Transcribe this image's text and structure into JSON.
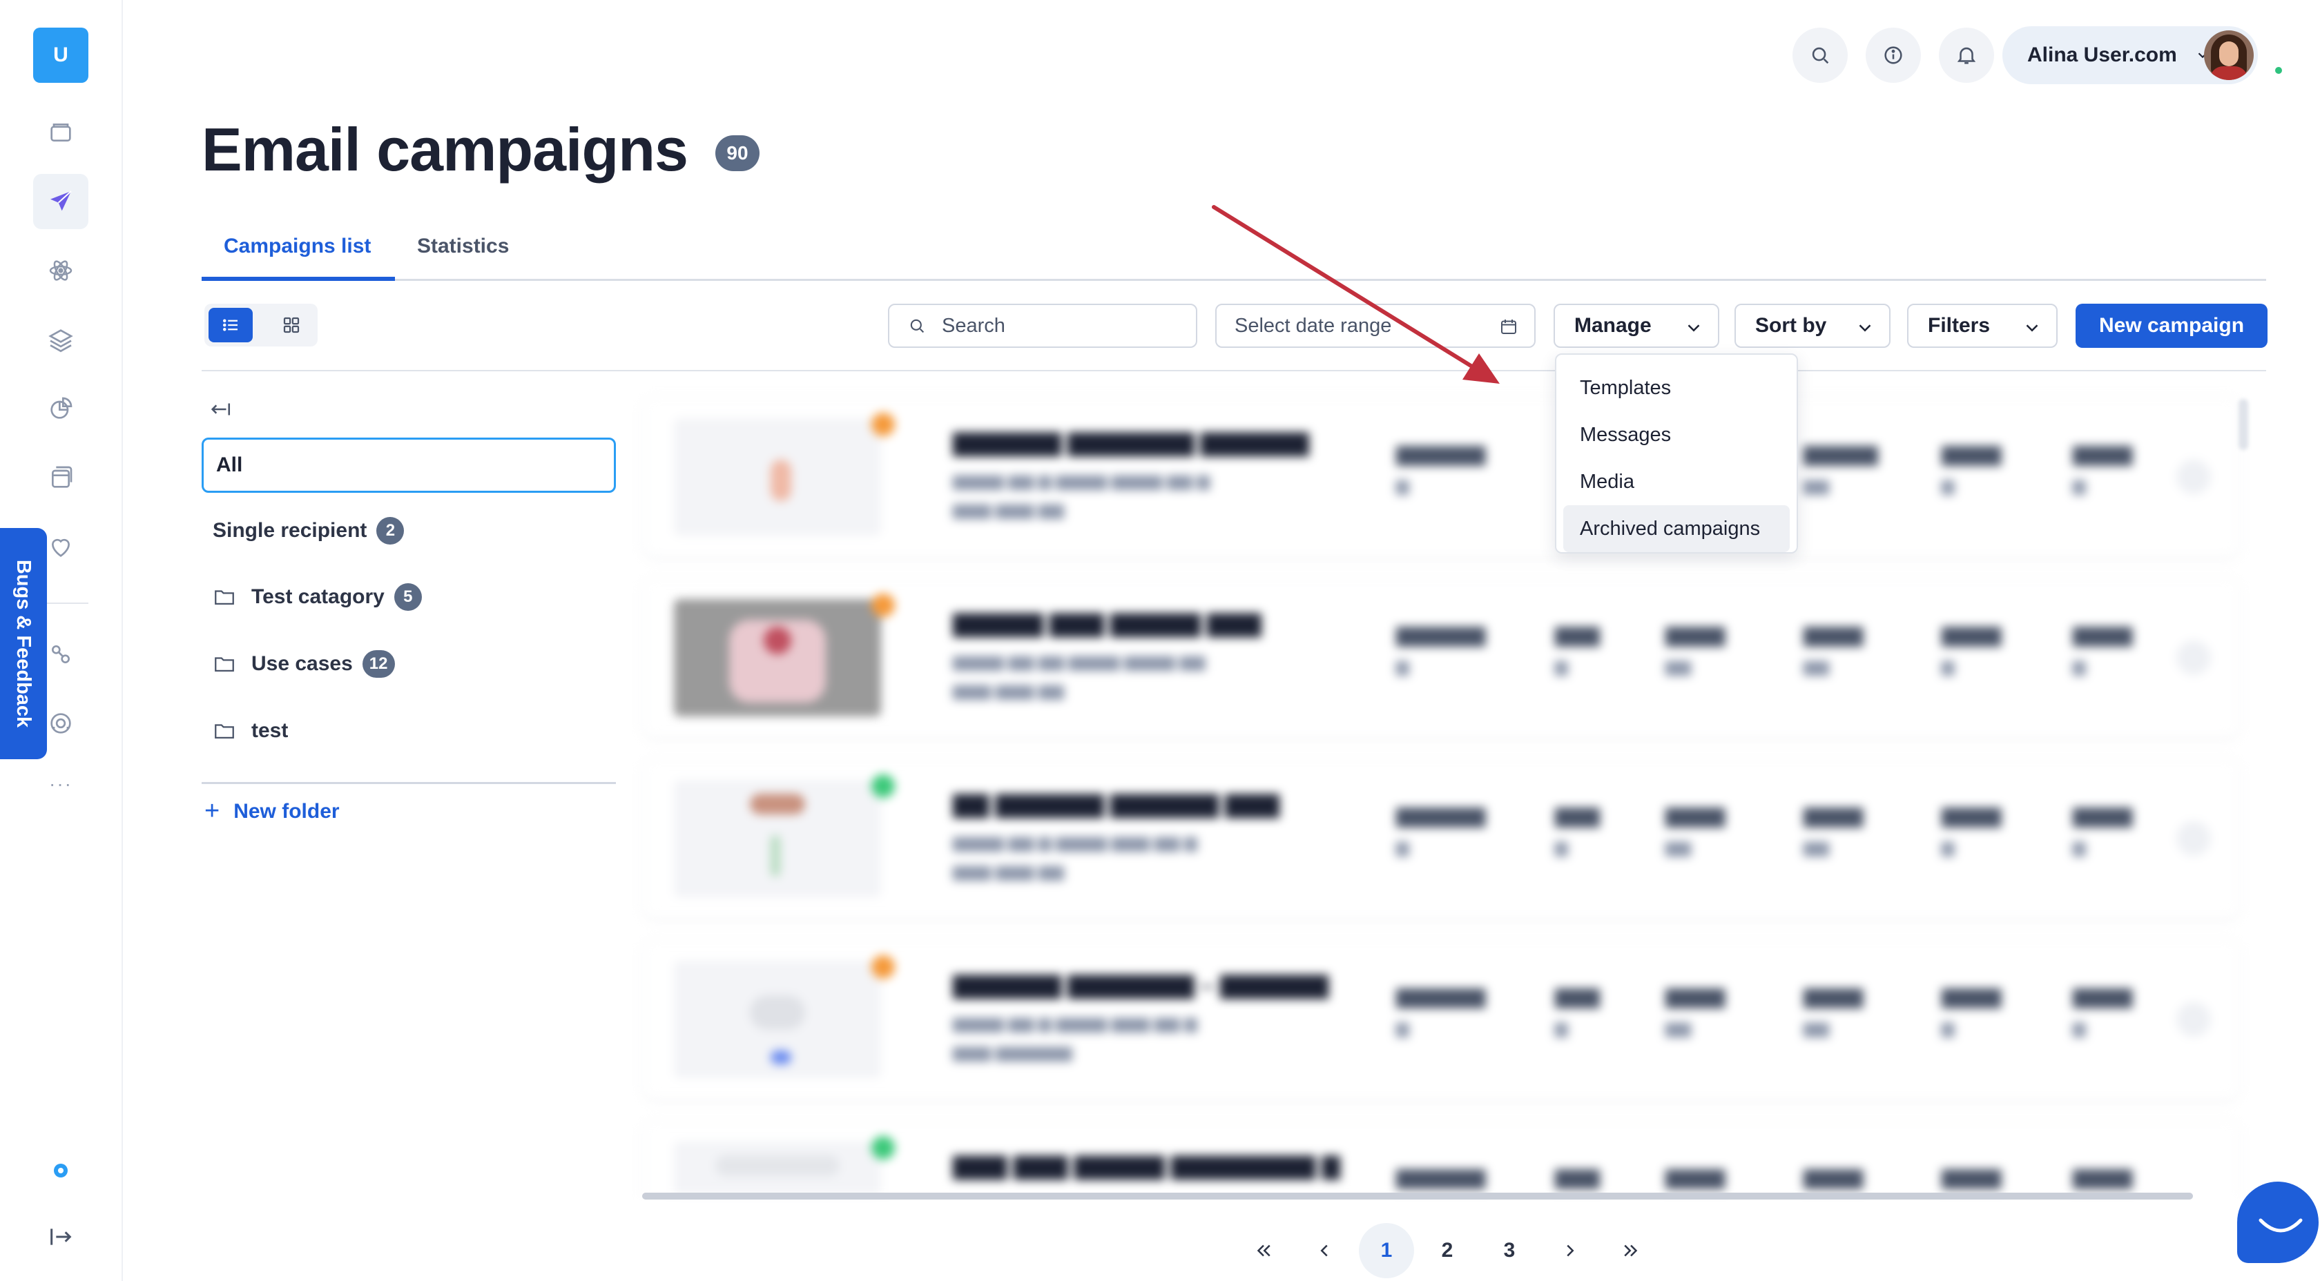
{
  "app": {
    "logo_letter": "U"
  },
  "rail": {
    "items": [
      {
        "name": "storage-icon"
      },
      {
        "name": "send-icon"
      },
      {
        "name": "atom-icon"
      },
      {
        "name": "layers-icon"
      },
      {
        "name": "analytics-icon"
      },
      {
        "name": "pages-icon"
      },
      {
        "name": "heart-icon"
      },
      {
        "name": "automation-icon"
      },
      {
        "name": "support-icon"
      }
    ],
    "more": "···",
    "bottom": [
      {
        "name": "settings-icon"
      },
      {
        "name": "logout-icon"
      }
    ]
  },
  "feedback_tab": {
    "label": "Bugs & Feedback"
  },
  "topbar": {
    "icons": [
      "search-icon",
      "info-icon",
      "bell-icon"
    ],
    "user": {
      "name": "Alina User.com"
    }
  },
  "page": {
    "title": "Email campaigns",
    "count": "90"
  },
  "tabs": [
    {
      "label": "Campaigns list",
      "active": true
    },
    {
      "label": "Statistics",
      "active": false
    }
  ],
  "toolbar": {
    "search_placeholder": "Search",
    "date_placeholder": "Select date range",
    "manage_label": "Manage",
    "sort_label": "Sort by",
    "filters_label": "Filters",
    "new_campaign_label": "New campaign"
  },
  "manage_menu": {
    "items": [
      "Templates",
      "Messages",
      "Media",
      "Archived campaigns"
    ],
    "highlighted": "Archived campaigns"
  },
  "folders": {
    "all_label": "All",
    "items": [
      {
        "label": "Single recipient",
        "count": "2",
        "folder": false
      },
      {
        "label": "Test catagory",
        "count": "5",
        "folder": true
      },
      {
        "label": "Use cases",
        "count": "12",
        "folder": true
      },
      {
        "label": "test",
        "count": "",
        "folder": true
      }
    ],
    "new_folder_label": "New folder"
  },
  "pagination": {
    "pages": [
      "1",
      "2",
      "3"
    ],
    "current": "1"
  },
  "colors": {
    "primary": "#1e5ed9",
    "accent": "#2a9df4",
    "badge": "#5b6b85",
    "annotation_arrow": "#c2303d"
  }
}
